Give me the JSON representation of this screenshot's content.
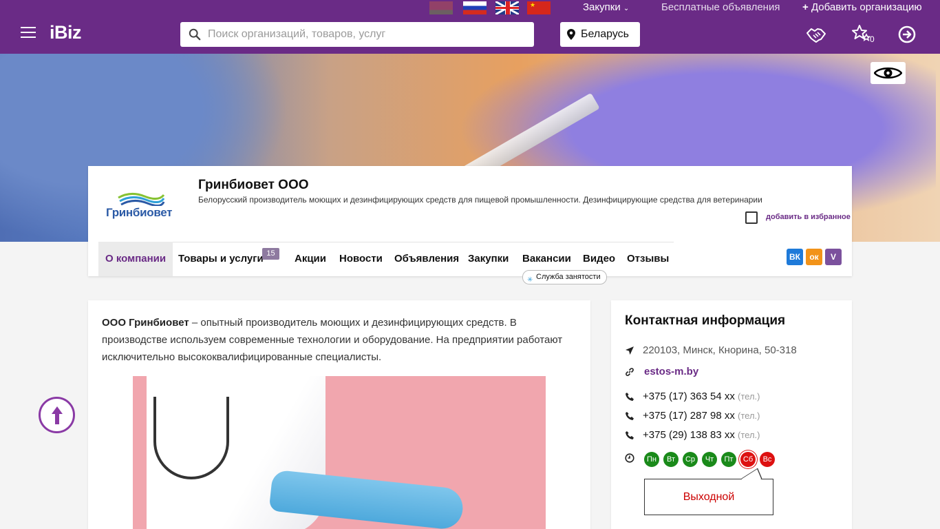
{
  "topbar": {
    "flags": [
      "belarus-flag",
      "russia-flag",
      "uk-flag",
      "china-flag"
    ],
    "zakupki": "Закупки",
    "free_ads": "Бесплатные объявления",
    "add_org": "Добавить организацию"
  },
  "header": {
    "logo": "iBiz",
    "search_placeholder": "Поиск организаций, товаров, услуг",
    "region": "Беларусь",
    "favorites_count": "0",
    "accent_color": "#6a2b86"
  },
  "company": {
    "name": "Гринбиовет ООО",
    "logo_text": "Гринбиовет",
    "description": "Белорусский производитель моющих и дезинфицирующих средств для пищевой промышленности. Дезинфицирующие средства для ветеринарии",
    "favorite_label": "добавить в избранное",
    "tabs": [
      {
        "label": "О компании"
      },
      {
        "label": "Товары и услуги"
      },
      {
        "label": "Акции"
      },
      {
        "label": "Новости"
      },
      {
        "label": "Объявления"
      },
      {
        "label": "Закупки"
      },
      {
        "label": "Вакансии"
      },
      {
        "label": "Видео"
      },
      {
        "label": "Отзывы"
      }
    ],
    "products_count": "15",
    "jobs_tip": "Служба занятости",
    "social": {
      "vk": "ВК",
      "ok": "ок",
      "viber": "V"
    }
  },
  "about": {
    "lead_bold": "ООО Гринбиовет",
    "lead_rest": " – опытный производитель моющих и дезинфицирующих средств. В производстве используем современные технологии и оборудование. На предприятии работают исключительно высококвалифицированные специалисты."
  },
  "contacts": {
    "title": "Контактная информация",
    "address": "220103, Минск, Кнорина, 50-318",
    "website": "estos-m.by",
    "phones": [
      {
        "number": "+375 (17) 363 54 xx",
        "type": "(тел.)"
      },
      {
        "number": "+375 (17) 287 98 xx",
        "type": "(тел.)"
      },
      {
        "number": "+375 (29) 138 83 xx",
        "type": "(тел.)"
      }
    ],
    "days": [
      {
        "label": "Пн",
        "status": "work"
      },
      {
        "label": "Вт",
        "status": "work"
      },
      {
        "label": "Ср",
        "status": "work"
      },
      {
        "label": "Чт",
        "status": "work"
      },
      {
        "label": "Пт",
        "status": "work"
      },
      {
        "label": "Сб",
        "status": "off"
      },
      {
        "label": "Вс",
        "status": "off"
      }
    ],
    "day_off_text": "Выходной"
  }
}
